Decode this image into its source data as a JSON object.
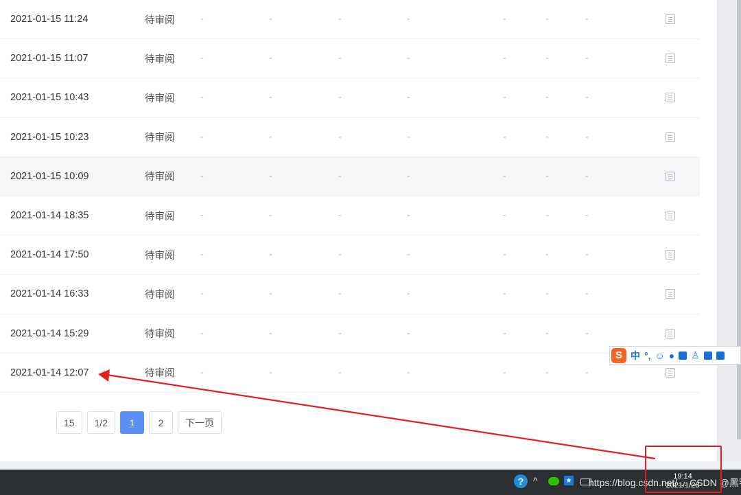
{
  "table": {
    "status_text": "待审阅",
    "dash": "-",
    "rows": [
      {
        "time": "2021-01-15 11:24",
        "status": "待审阅"
      },
      {
        "time": "2021-01-15 11:07",
        "status": "待审阅"
      },
      {
        "time": "2021-01-15 10:43",
        "status": "待审阅"
      },
      {
        "time": "2021-01-15 10:23",
        "status": "待审阅"
      },
      {
        "time": "2021-01-15 10:09",
        "status": "待审阅"
      },
      {
        "time": "2021-01-14 18:35",
        "status": "待审阅"
      },
      {
        "time": "2021-01-14 17:50",
        "status": "待审阅"
      },
      {
        "time": "2021-01-14 16:33",
        "status": "待审阅"
      },
      {
        "time": "2021-01-14 15:29",
        "status": "待审阅"
      },
      {
        "time": "2021-01-14 12:07",
        "status": "待审阅"
      }
    ]
  },
  "pager": {
    "page_size": "15",
    "page_count": "1/2",
    "page1": "1",
    "page2": "2",
    "next": "下一页"
  },
  "taskbar": {
    "help": "?",
    "chevron": "^",
    "watermark": "https://blog.csdn.net/…  CSDN @黑客幻象q",
    "time": "19:14",
    "date": "2021/1/28"
  },
  "ime": {
    "logo": "S",
    "lang": "中",
    "punct": "°,"
  },
  "colors": {
    "accent": "#5a8ff8",
    "annotation": "#e02020"
  }
}
